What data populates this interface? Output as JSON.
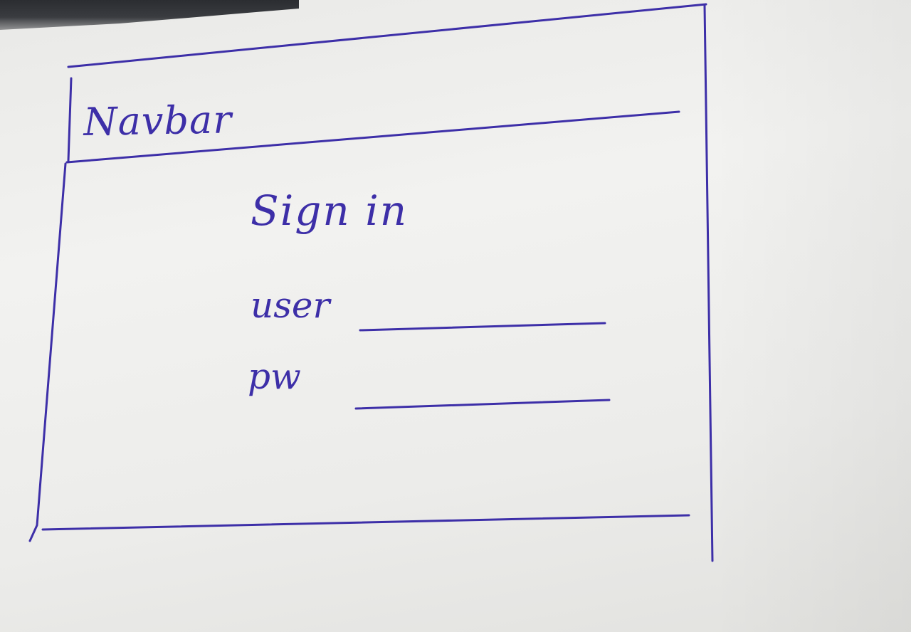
{
  "navbar": {
    "label": "Navbar"
  },
  "signin": {
    "title": "Sign in",
    "user_label": "user",
    "user_value": "",
    "password_label": "pw",
    "password_value": ""
  },
  "colors": {
    "ink": "#3d2fa8",
    "paper": "#efefed"
  }
}
